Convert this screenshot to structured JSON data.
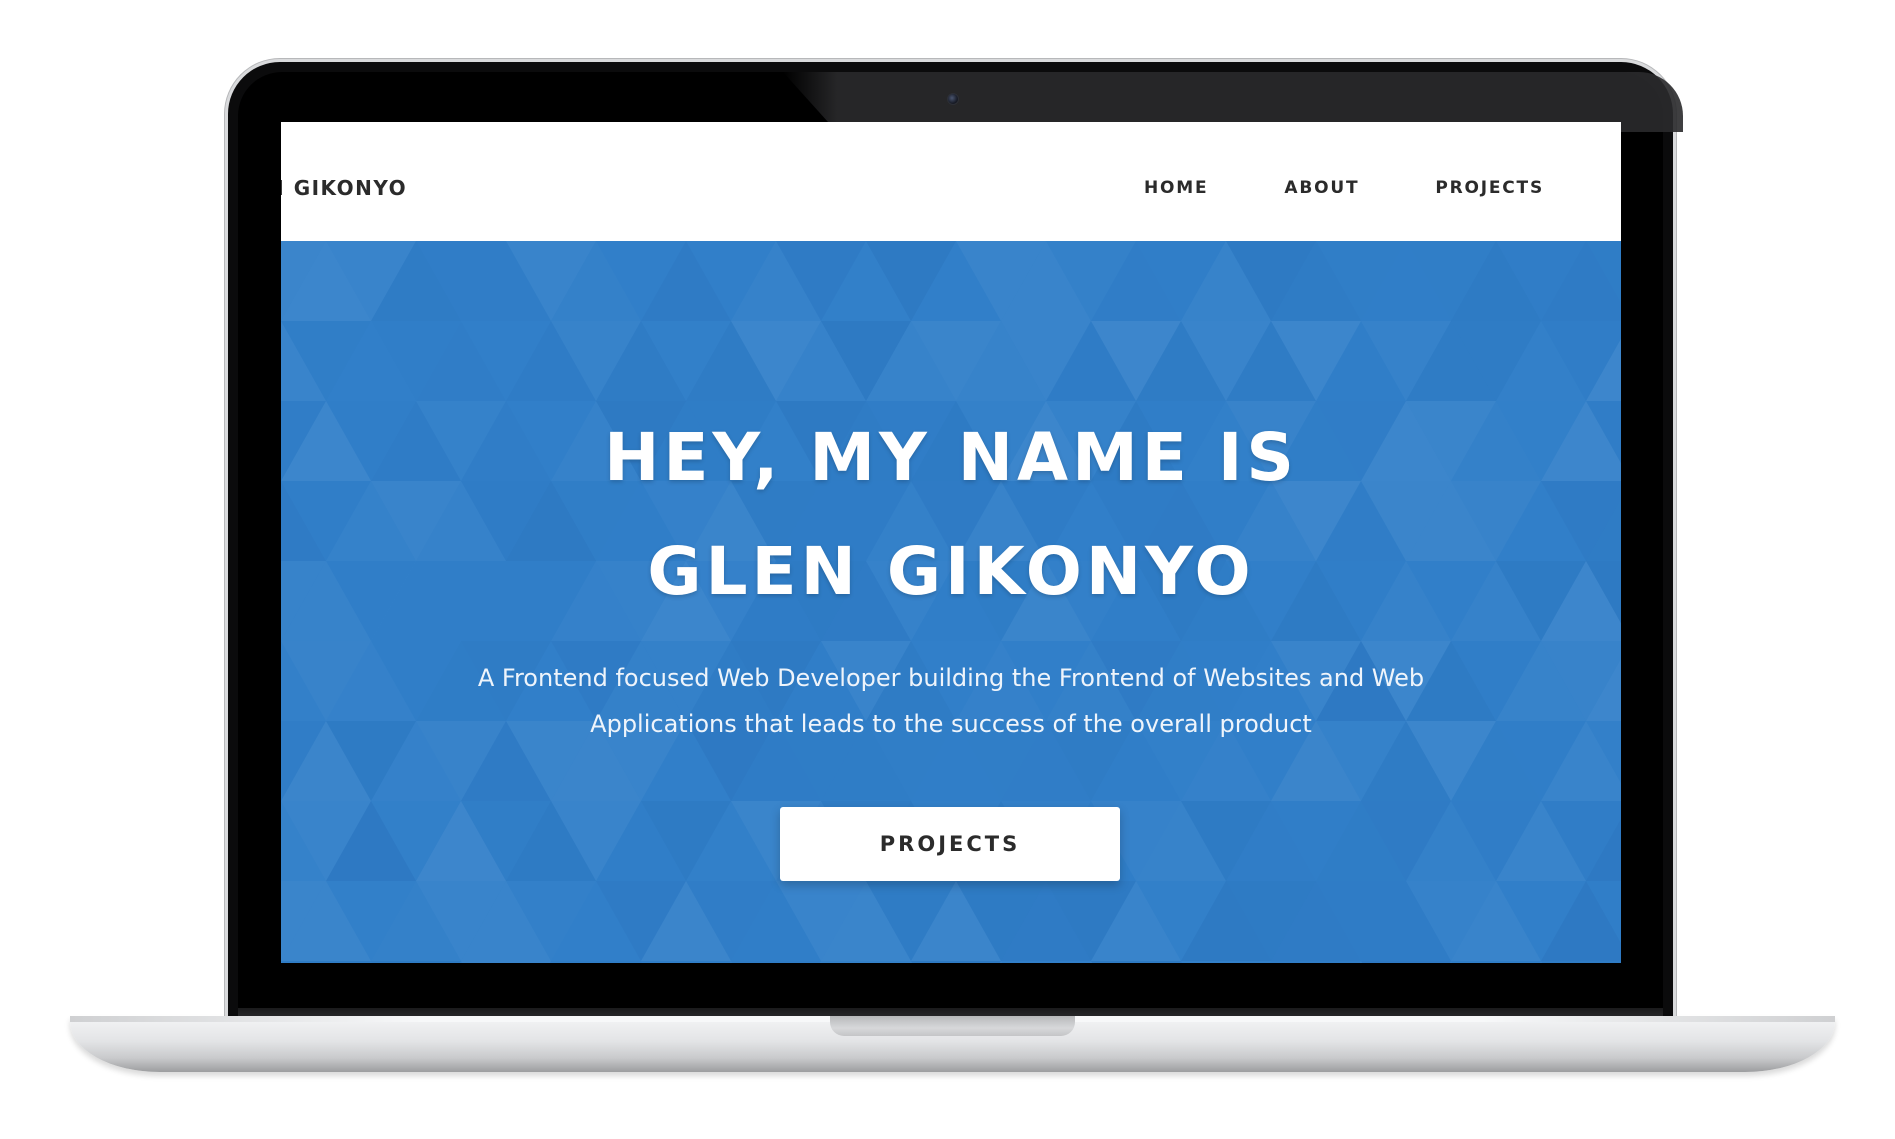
{
  "navbar": {
    "brand": "N GIKONYO",
    "links": [
      {
        "label": "HOME"
      },
      {
        "label": "ABOUT"
      },
      {
        "label": "PROJECTS"
      }
    ]
  },
  "hero": {
    "title": "HEY, MY NAME IS GLEN GIKONYO",
    "subtitle": "A Frontend focused Web Developer building the Frontend of Websites and Web Applications that leads to the success of the overall product",
    "cta_label": "PROJECTS",
    "background_color": "#317fc9"
  },
  "colors": {
    "bezel": "#0b0b0c",
    "nav_text": "#2b2b2b",
    "hero_blue": "#317fc9",
    "button_bg": "#ffffff"
  },
  "icons": {
    "camera": "webcam-icon"
  }
}
